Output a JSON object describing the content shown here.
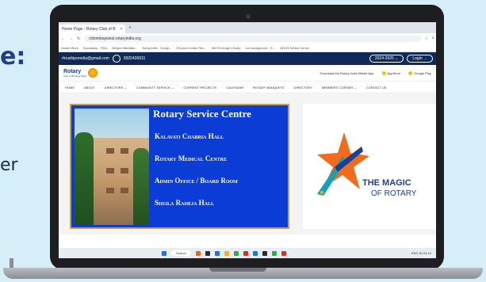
{
  "backdrop": {
    "colon": "e:",
    "partial_word": "er"
  },
  "browser": {
    "tab_title": "Home Page - Rotary Club of B",
    "tab_close": "×",
    "new_tab": "+",
    "url": "rcbombaywest.rotaryindia.org",
    "bookmarks": [
      "Hostel Work",
      "Scandasip - Files",
      "Belgan Manufac...",
      "fixing bolts - Googl...",
      "Chrysen Indian Rec...",
      "NDOS image Library",
      "Ion background - G...",
      "NDOS NGlan Genes"
    ]
  },
  "site": {
    "email": "rhrushiporedia@gmail.com",
    "phone": "9920426911",
    "year_selector": "2024-2025 ⌄",
    "login": "Login →",
    "logo_text": "Rotary",
    "logo_sub": "Club of Bombay West",
    "download_text": "Download the Rotary India Mobile App",
    "appstore": "AppStore",
    "googleplay": "Google Play",
    "nav": [
      "HOME",
      "ABOUT",
      "DIRECTORS ⌄",
      "COMMUNITY SERVICE ⌄",
      "CURRENT PROJECTS",
      "CALENDAR",
      "ROTARY BANQUETS",
      "DIRECTORY",
      "MEMBERS' CORNER ⌄",
      "CONTACT US"
    ]
  },
  "panel": {
    "title": "Rotary Service Centre",
    "lines": [
      "Kalavati Chabria Hall",
      "Rotary Medical Centre",
      "Admin Office / Board Room",
      "Sheila Raheja Hall"
    ]
  },
  "magic": {
    "title": "THE MAGIC",
    "subtitle": "OF ROTARY"
  },
  "taskbar": {
    "search": "Search",
    "tray": "ENG  IN  24-10"
  },
  "colors": {
    "site_topbar": "#0f2a56",
    "panel_blue": "#0b3cd6",
    "rotary_blue": "#1d3f8f"
  }
}
